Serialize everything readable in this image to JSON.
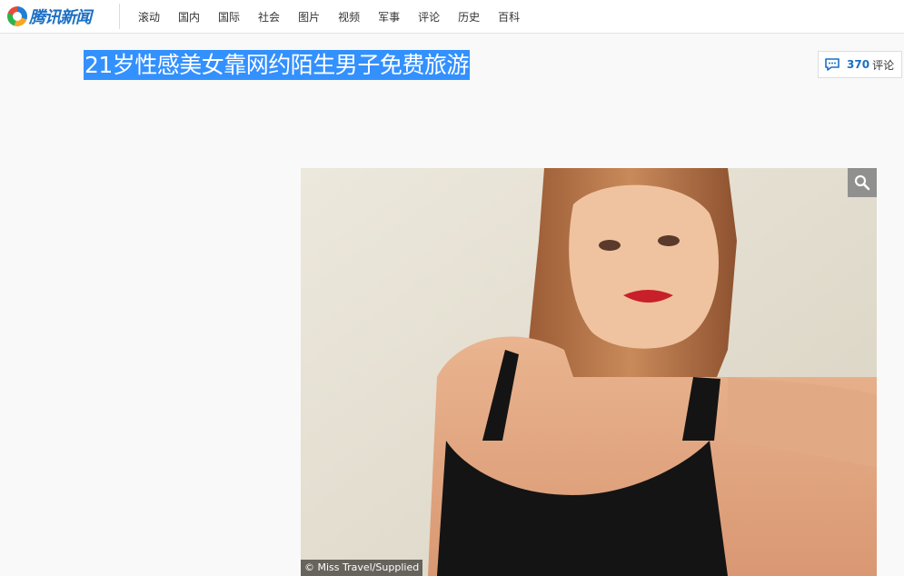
{
  "header": {
    "logo_text": "腾讯新闻",
    "nav": [
      "滚动",
      "国内",
      "国际",
      "社会",
      "图片",
      "视频",
      "军事",
      "评论",
      "历史",
      "百科"
    ]
  },
  "article": {
    "title": "21岁性感美女靠网约陌生男子免费旅游"
  },
  "comments": {
    "count": "370",
    "label": "评论"
  },
  "photo": {
    "credit": "© Miss Travel/Supplied"
  },
  "icons": {
    "logo": "tencent-news-logo-icon",
    "comment": "speech-bubble-icon",
    "zoom": "magnifier-icon"
  },
  "colors": {
    "accent": "#1a6fc4",
    "selection": "#3390ff",
    "background": "#f9f9f9"
  }
}
